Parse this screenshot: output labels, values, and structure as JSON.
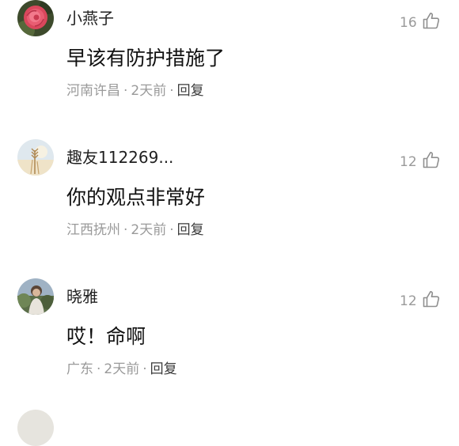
{
  "comments": [
    {
      "username": "小燕子",
      "text": "早该有防护措施了",
      "location": "河南许昌",
      "time": "2天前",
      "reply_label": "回复",
      "likes": "16",
      "avatar_icon": "rose-photo-avatar"
    },
    {
      "username": "趣友112269...",
      "text": "你的观点非常好",
      "location": "江西抚州",
      "time": "2天前",
      "reply_label": "回复",
      "likes": "12",
      "avatar_icon": "wheat-photo-avatar"
    },
    {
      "username": "晓雅",
      "text": "哎！命啊",
      "location": "广东",
      "time": "2天前",
      "reply_label": "回复",
      "likes": "12",
      "avatar_icon": "portrait-photo-avatar"
    }
  ],
  "colors": {
    "username": "#1f1f1f",
    "text": "#111111",
    "meta": "#9a9a9a",
    "reply": "#3a3a3a"
  }
}
